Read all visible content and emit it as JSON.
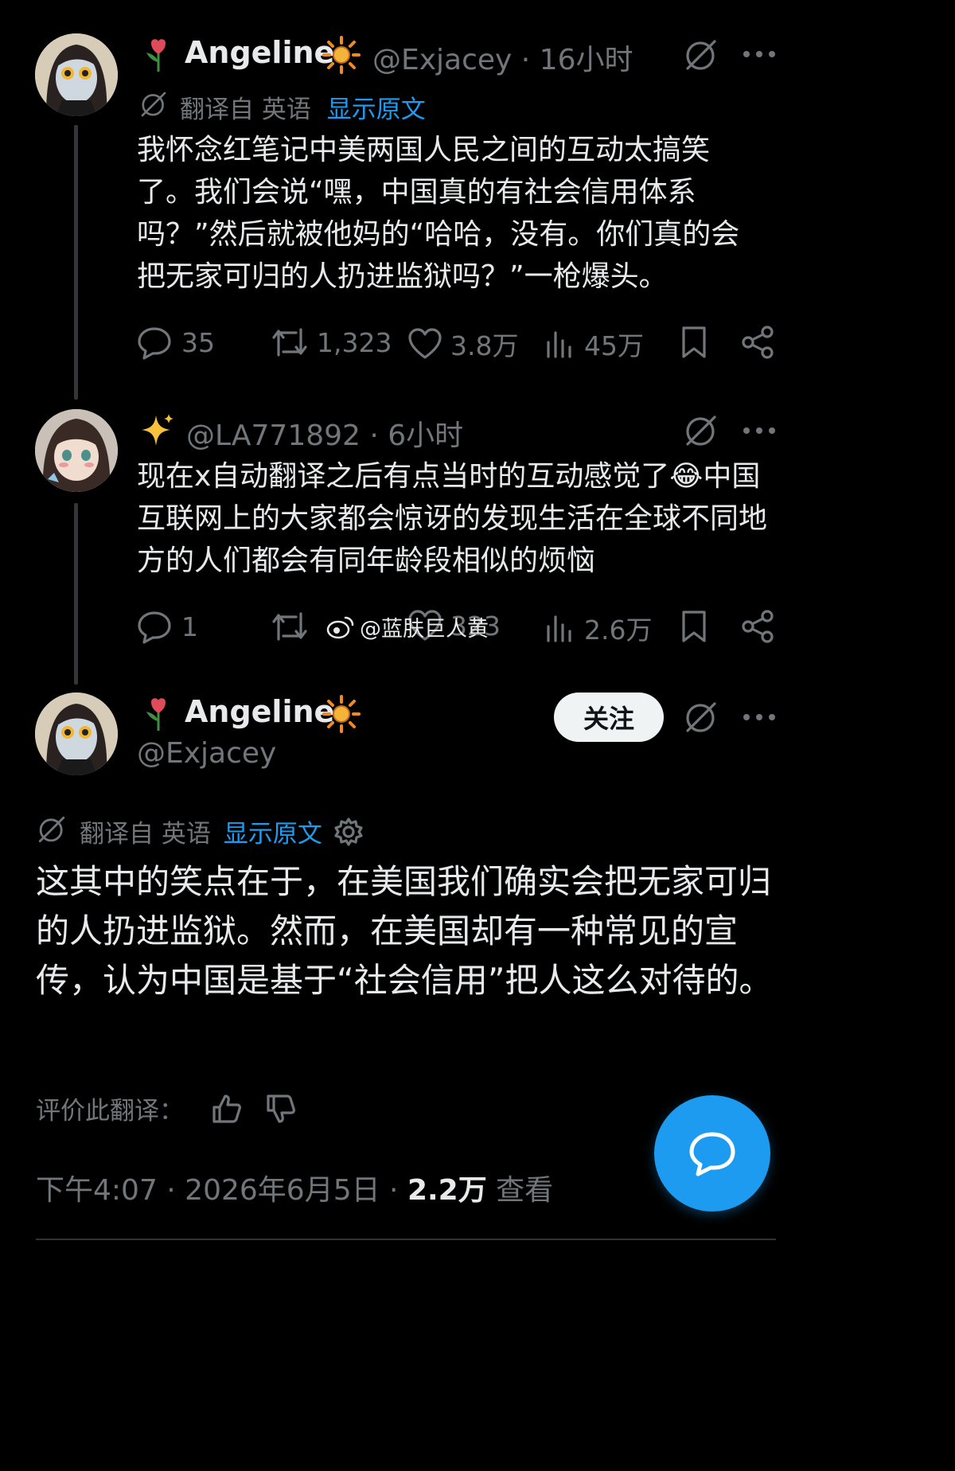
{
  "tweet1": {
    "name": "Angeline",
    "handle": "@Exjacey · 16小时",
    "translated_from": "翻译自 英语",
    "show_original": "显示原文",
    "text": "我怀念红笔记中美两国人民之间的互动太搞笑了。我们会说“嘿，中国真的有社会信用体系吗？”然后就被他妈的“哈哈，没有。你们真的会把无家可归的人扔进监狱吗？”一枪爆头。",
    "replies": "35",
    "retweets": "1,323",
    "likes": "3.8万",
    "views": "45万"
  },
  "tweet2": {
    "handle": "@LA771892 · 6小时",
    "text": "现在x自动翻译之后有点当时的互动感觉了😂中国互联网上的大家都会惊讶的发现生活在全球不同地方的人们都会有同年龄段相似的烦恼",
    "replies": "1",
    "likes": "323",
    "views": "2.6万"
  },
  "watermark": "@蓝肤巨人黄",
  "main": {
    "name": "Angeline",
    "handle": "@Exjacey",
    "follow_label": "关注",
    "translated_from": "翻译自 英语",
    "show_original": "显示原文",
    "text": "这其中的笑点在于，在美国我们确实会把无家可归的人扔进监狱。然而，在美国却有一种常见的宣传，认为中国是基于“社会信用”把人这么对待的。",
    "rate_label": "评价此翻译：",
    "time": "下午4:07 · 2026年6月5日 · ",
    "views_count": "2.2万",
    "views_label": " 查看"
  },
  "colors": {
    "background": "#000000",
    "text": "#e7e9ea",
    "muted": "#71767b",
    "accent": "#1d9bf0"
  },
  "icons": [
    "rose-icon",
    "sun-icon",
    "grok-icon",
    "more-icon",
    "translate-icon",
    "reply-icon",
    "retweet-icon",
    "like-icon",
    "views-icon",
    "bookmark-icon",
    "share-icon",
    "sparkles-icon",
    "gear-icon",
    "thumbs-up-icon",
    "thumbs-down-icon",
    "weibo-icon",
    "compose-reply-icon"
  ]
}
